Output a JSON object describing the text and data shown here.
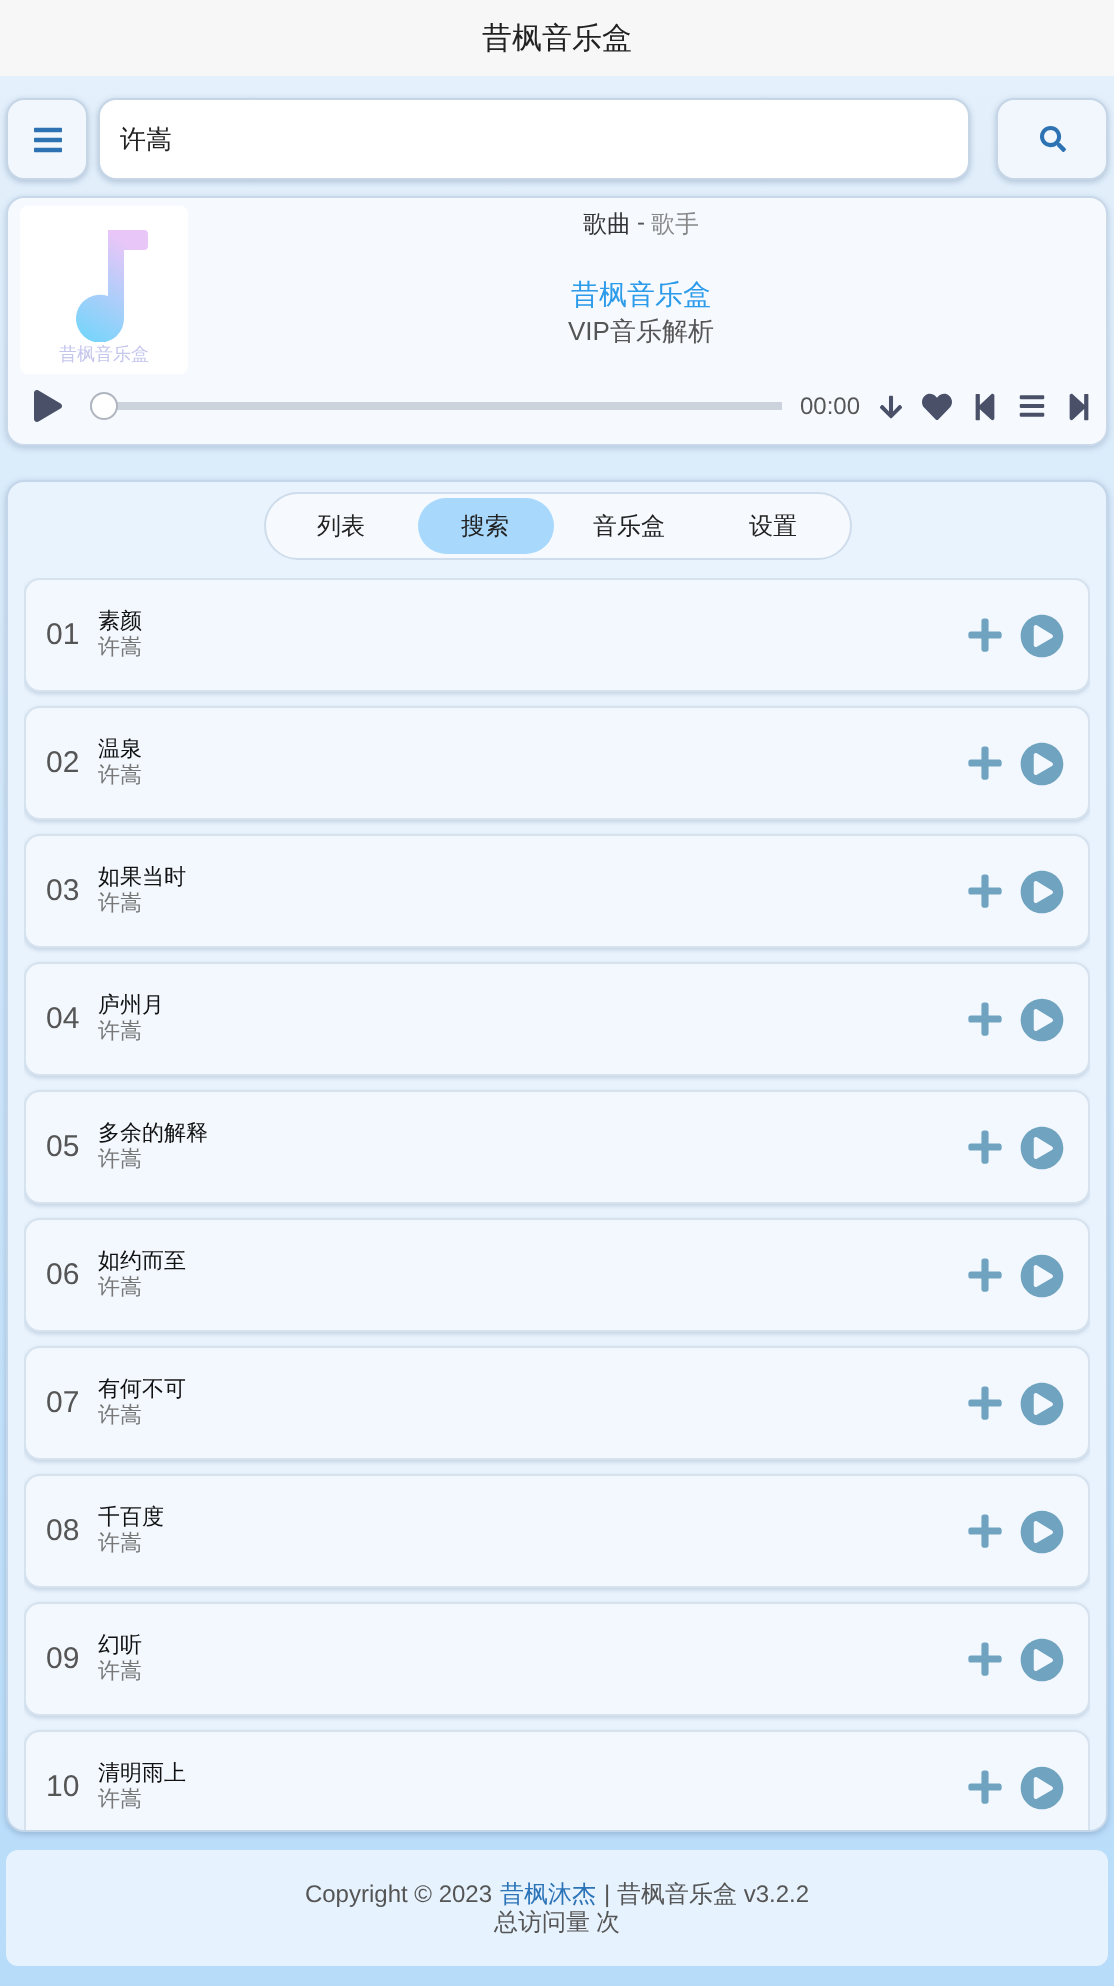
{
  "header": {
    "title": "昔枫音乐盒"
  },
  "search": {
    "value": "许嵩"
  },
  "player": {
    "song": "歌曲",
    "separator": "-",
    "singer": "歌手",
    "cover_text": "昔枫音乐盒",
    "brand": "昔枫音乐盒",
    "subtitle": "VIP音乐解析",
    "time": "00:00",
    "progress": {
      "level": 0
    }
  },
  "tabs": [
    {
      "label": "列表",
      "selected": false
    },
    {
      "label": "搜索",
      "selected": true
    },
    {
      "label": "音乐盒",
      "selected": false
    },
    {
      "label": "设置",
      "selected": false
    }
  ],
  "songs": [
    {
      "index": "01",
      "title": "素颜",
      "artist": "许嵩"
    },
    {
      "index": "02",
      "title": "温泉",
      "artist": "许嵩"
    },
    {
      "index": "03",
      "title": "如果当时",
      "artist": "许嵩"
    },
    {
      "index": "04",
      "title": "庐州月",
      "artist": "许嵩"
    },
    {
      "index": "05",
      "title": "多余的解释",
      "artist": "许嵩"
    },
    {
      "index": "06",
      "title": "如约而至",
      "artist": "许嵩"
    },
    {
      "index": "07",
      "title": "有何不可",
      "artist": "许嵩"
    },
    {
      "index": "08",
      "title": "千百度",
      "artist": "许嵩"
    },
    {
      "index": "09",
      "title": "幻听",
      "artist": "许嵩"
    },
    {
      "index": "10",
      "title": "清明雨上",
      "artist": "许嵩"
    }
  ],
  "footer": {
    "copyright": "Copyright © 2023",
    "author": "昔枫沐杰",
    "rest": "| 昔枫音乐盒 v3.2.2",
    "visits": "总访问量 次"
  }
}
